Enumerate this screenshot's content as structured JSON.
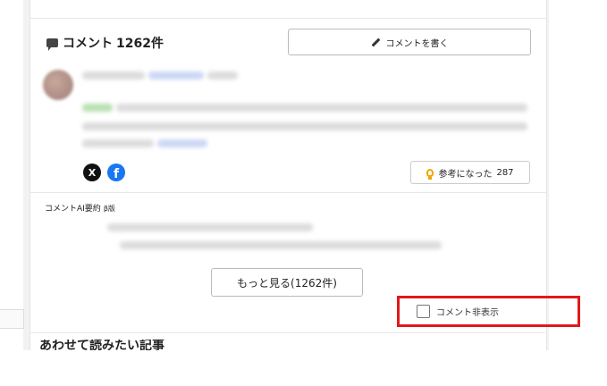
{
  "comments": {
    "title": "コメント",
    "count": "1262件",
    "write_label": "コメントを書く",
    "helpful_label": "参考になった",
    "helpful_count": "287",
    "share": {
      "x_glyph": "X",
      "facebook_glyph": "f"
    }
  },
  "ai_summary": {
    "label": "コメントAI要約",
    "beta": "β版"
  },
  "more_button": "もっと見る(1262件)",
  "hide_toggle": {
    "label": "コメント非表示",
    "checked": false
  },
  "next_section": {
    "title": "あわせて読みたい記事"
  },
  "colors": {
    "highlight": "#e0191b",
    "facebook": "#1877f2",
    "bulb": "#f0a500"
  }
}
